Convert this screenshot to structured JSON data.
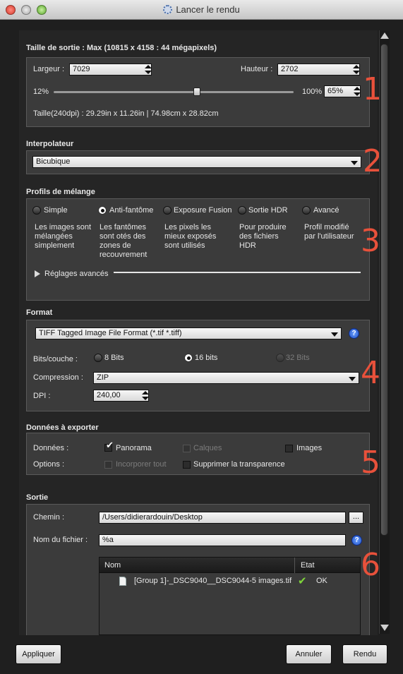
{
  "window": {
    "title": "Lancer le rendu"
  },
  "colors": {
    "accent_number": "#e8513b",
    "panel": "#3b3b3b",
    "background": "#1f1f1f",
    "ok_check": "#7fd63a",
    "help_blue": "#2f66e0"
  },
  "output_size": {
    "heading": "Taille de sortie : Max (10815 x 4158 : 44 mégapixels)",
    "width_label": "Largeur :",
    "width_value": "7029",
    "height_label": "Hauteur :",
    "height_value": "2702",
    "slider_min": "12%",
    "slider_max": "100%",
    "scale_value": "65%",
    "slider_level_percent": 65,
    "size_info": "Taille(240dpi) : 29.29in x 11.26in | 74.98cm x 28.82cm",
    "number": "1"
  },
  "interpolator": {
    "heading": "Interpolateur",
    "value": "Bicubique",
    "number": "2"
  },
  "blend_profiles": {
    "heading": "Profils de mélange",
    "options": [
      {
        "label": "Simple",
        "desc": "Les images sont mélangées simplement",
        "selected": false
      },
      {
        "label": "Anti-fantôme",
        "desc": "Les fantômes sont otés des zones de recouvrement",
        "selected": true
      },
      {
        "label": "Exposure Fusion",
        "desc": "Les pixels les mieux exposés sont utilisés",
        "selected": false
      },
      {
        "label": "Sortie HDR",
        "desc": "Pour produire des fichiers HDR",
        "selected": false
      },
      {
        "label": "Avancé",
        "desc": "Profil modifié par l'utilisateur",
        "selected": false
      }
    ],
    "advanced_label": "Réglages avancés",
    "number": "3"
  },
  "format": {
    "heading": "Format",
    "file_format": "TIFF Tagged Image File Format (*.tif *.tiff)",
    "bits_label": "Bits/couche :",
    "bits_options": [
      {
        "label": "8 Bits",
        "selected": false,
        "enabled": true
      },
      {
        "label": "16 bits",
        "selected": true,
        "enabled": true
      },
      {
        "label": "32 Bits",
        "selected": false,
        "enabled": false
      }
    ],
    "compression_label": "Compression :",
    "compression_value": "ZIP",
    "dpi_label": "DPI :",
    "dpi_value": "240,00",
    "number": "4",
    "help": "?"
  },
  "export": {
    "heading": "Données à exporter",
    "data_label": "Données :",
    "data_options": [
      {
        "label": "Panorama",
        "checked": true,
        "enabled": true
      },
      {
        "label": "Calques",
        "checked": false,
        "enabled": false
      },
      {
        "label": "Images",
        "checked": false,
        "enabled": true
      }
    ],
    "options_label": "Options :",
    "options": [
      {
        "label": "Incorporer tout",
        "checked": false,
        "enabled": false
      },
      {
        "label": "Supprimer la transparence",
        "checked": false,
        "enabled": true
      }
    ],
    "number": "5"
  },
  "output": {
    "heading": "Sortie",
    "path_label": "Chemin :",
    "path_value": "/Users/didierardouin/Desktop",
    "browse_label": "...",
    "filename_label": "Nom du fichier :",
    "filename_value": "%a",
    "table_headers": [
      "Nom",
      "Etat"
    ],
    "rows": [
      {
        "name": "[Group 1]-_DSC9040__DSC9044-5 images.tif",
        "status": "OK"
      }
    ],
    "number": "6",
    "help": "?"
  },
  "buttons": {
    "apply": "Appliquer",
    "cancel": "Annuler",
    "render": "Rendu"
  }
}
